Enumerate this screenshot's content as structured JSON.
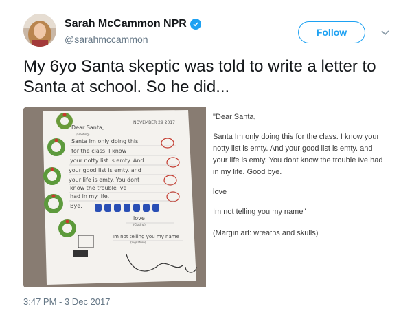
{
  "author": {
    "display_name": "Sarah McCammon NPR",
    "handle": "@sarahmccammon",
    "verified": true
  },
  "actions": {
    "follow_label": "Follow",
    "more_icon": "chevron-down-icon"
  },
  "tweet": {
    "text": "My 6yo Santa skeptic was told to write a letter to Santa at school. So he did...",
    "timestamp": "3:47 PM - 3 Dec 2017"
  },
  "transcript": {
    "greeting": "\"Dear Santa,",
    "body": "Santa Im only doing this for the class. I know your notty list is emty. And your good list is emty. and your life is emty. You dont know the trouble Ive had in my life. Good bye.",
    "closing": "love",
    "signature": "Im not telling you my name\"",
    "note": "(Margin art: wreaths and skulls)"
  },
  "letter_image": {
    "date": "NOVEMBER 29 2017",
    "greeting_label": "(Greeting)",
    "closing_label": "(Closing)",
    "signature_label": "(Signature)",
    "handwriting_lines": [
      "Dear Santa,",
      "Santa Im only doing this",
      "for the class. I know",
      "your notty list is emty. And",
      "your good list is emty. and",
      "your life is emty. You dont",
      "know the trouble Ive",
      "had in my life.",
      "Bye.",
      "love",
      "Im not telling you my name"
    ]
  },
  "colors": {
    "accent": "#1da1f2",
    "text": "#14171a",
    "secondary": "#657786"
  }
}
